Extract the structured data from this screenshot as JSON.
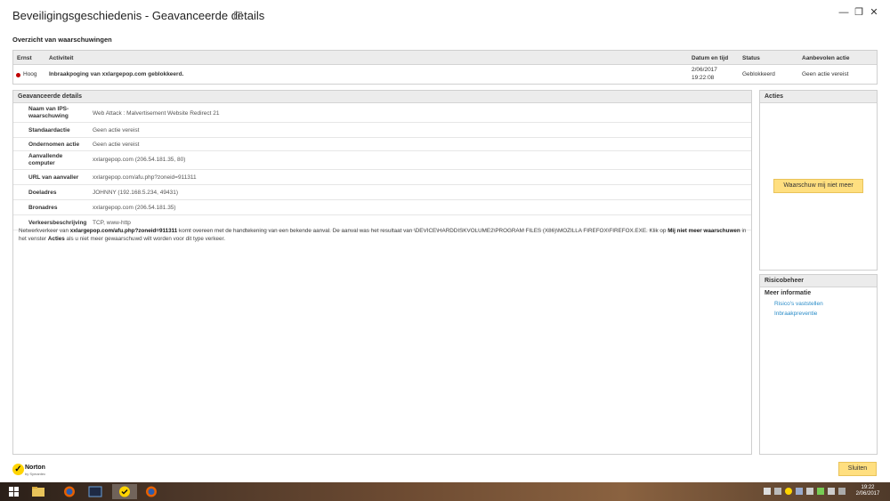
{
  "window": {
    "title": "Beveiligingsgeschiedenis - Geavanceerde details",
    "help": "?",
    "min": "—",
    "max": "❐",
    "close": "✕"
  },
  "overview": {
    "title": "Overzicht van waarschuwingen",
    "columns": [
      "Ernst",
      "Activiteit",
      "Datum en tijd",
      "Status",
      "Aanbevolen actie"
    ],
    "row": {
      "severity": "Hoog",
      "activity": "Inbraakpoging van xxlargepop.com geblokkeerd.",
      "date": "2/06/2017",
      "time": "19:22:08",
      "status": "Geblokkeerd",
      "action": "Geen actie vereist",
      "severity_color": "#c00000"
    }
  },
  "details": {
    "title": "Geavanceerde details",
    "rows": [
      {
        "label": "Naam van IPS-waarschuwing",
        "value": "Web Attack : Malvertisement Website Redirect 21"
      },
      {
        "label": "Standaardactie",
        "value": "Geen actie vereist"
      },
      {
        "label": "Ondernomen actie",
        "value": "Geen actie vereist"
      },
      {
        "label": "Aanvallende computer",
        "value": "xxlargepop.com (206.54.181.35, 80)"
      },
      {
        "label": "URL van aanvaller",
        "value": "xxlargepop.com/afu.php?zoneid=911311"
      },
      {
        "label": "Doeladres",
        "value": "JOHNNY (192.168.5.234, 49431)"
      },
      {
        "label": "Bronadres",
        "value": "xxlargepop.com (206.54.181.35)"
      },
      {
        "label": "Verkeersbeschrijving",
        "value": "TCP, www-http"
      }
    ],
    "description": {
      "p1": "Netwerkverkeer van ",
      "b1": "xxlargepop.com/afu.php?zoneid=911311",
      "p2": " komt overeen met de handtekening van een bekende aanval. De aanval was het resultaat van \\DEVICE\\HARDDISKVOLUME2\\PROGRAM FILES (X86)\\MOZILLA FIREFOX\\FIREFOX.EXE. Klik op ",
      "b2": "Mij niet meer waarschuwen",
      "p3": " in het venster ",
      "b3": "Acties",
      "p4": " als u niet meer gewaarschuwd wilt worden voor dit type verkeer."
    }
  },
  "actions": {
    "title": "Acties",
    "button": "Waarschuw mij niet meer"
  },
  "risk": {
    "title": "Risicobeheer",
    "more_info": "Meer informatie",
    "links": [
      "Risico's vaststellen",
      "Inbraakpreventie"
    ]
  },
  "footer": {
    "brand": "Norton",
    "brand_sub": "by Symantec",
    "close_button": "Sluiten"
  },
  "taskbar": {
    "time": "19:22",
    "date": "2/06/2017",
    "accent": "#ffdf80"
  }
}
